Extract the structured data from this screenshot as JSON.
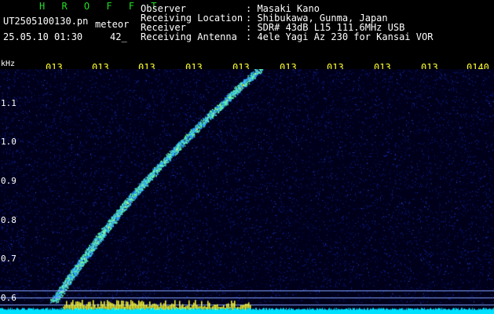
{
  "header": {
    "brand": "H R O F F T",
    "filename": "UT2505100130.pn",
    "file_sub": "meteor",
    "datetime": "25.05.10 01:30",
    "count": "42_"
  },
  "station": [
    {
      "label": "Observer",
      "value": ": Masaki Kano"
    },
    {
      "label": "Receiving Location",
      "value": ": Shibukawa, Gunma, Japan"
    },
    {
      "label": "Receiver",
      "value": ": SDR# 43dB L15 111.6MHz USB"
    },
    {
      "label": "Receiving Antenna",
      "value": ": 4ele Yagi Az 230 for Kansai VOR"
    }
  ],
  "axis": {
    "freq_unit": "kHz",
    "time_ticks": [
      "013",
      "013",
      "013",
      "013",
      "013",
      "013",
      "013",
      "013",
      "013",
      "0140"
    ],
    "freq_ticks": [
      "1.1",
      "1.0",
      "0.9",
      "0.8",
      "0.7",
      "0.6"
    ]
  },
  "colors": {
    "background": "#00001a",
    "noise": "#1a33cc",
    "echo_core": "#66ffaa",
    "echo_edge": "#2aa0ff",
    "guide_line": "#7fa0ff",
    "level_bar": "#ffff33",
    "baseline": "#00e0ff",
    "time_label": "#ffff33",
    "brand": "#22dd22"
  }
}
